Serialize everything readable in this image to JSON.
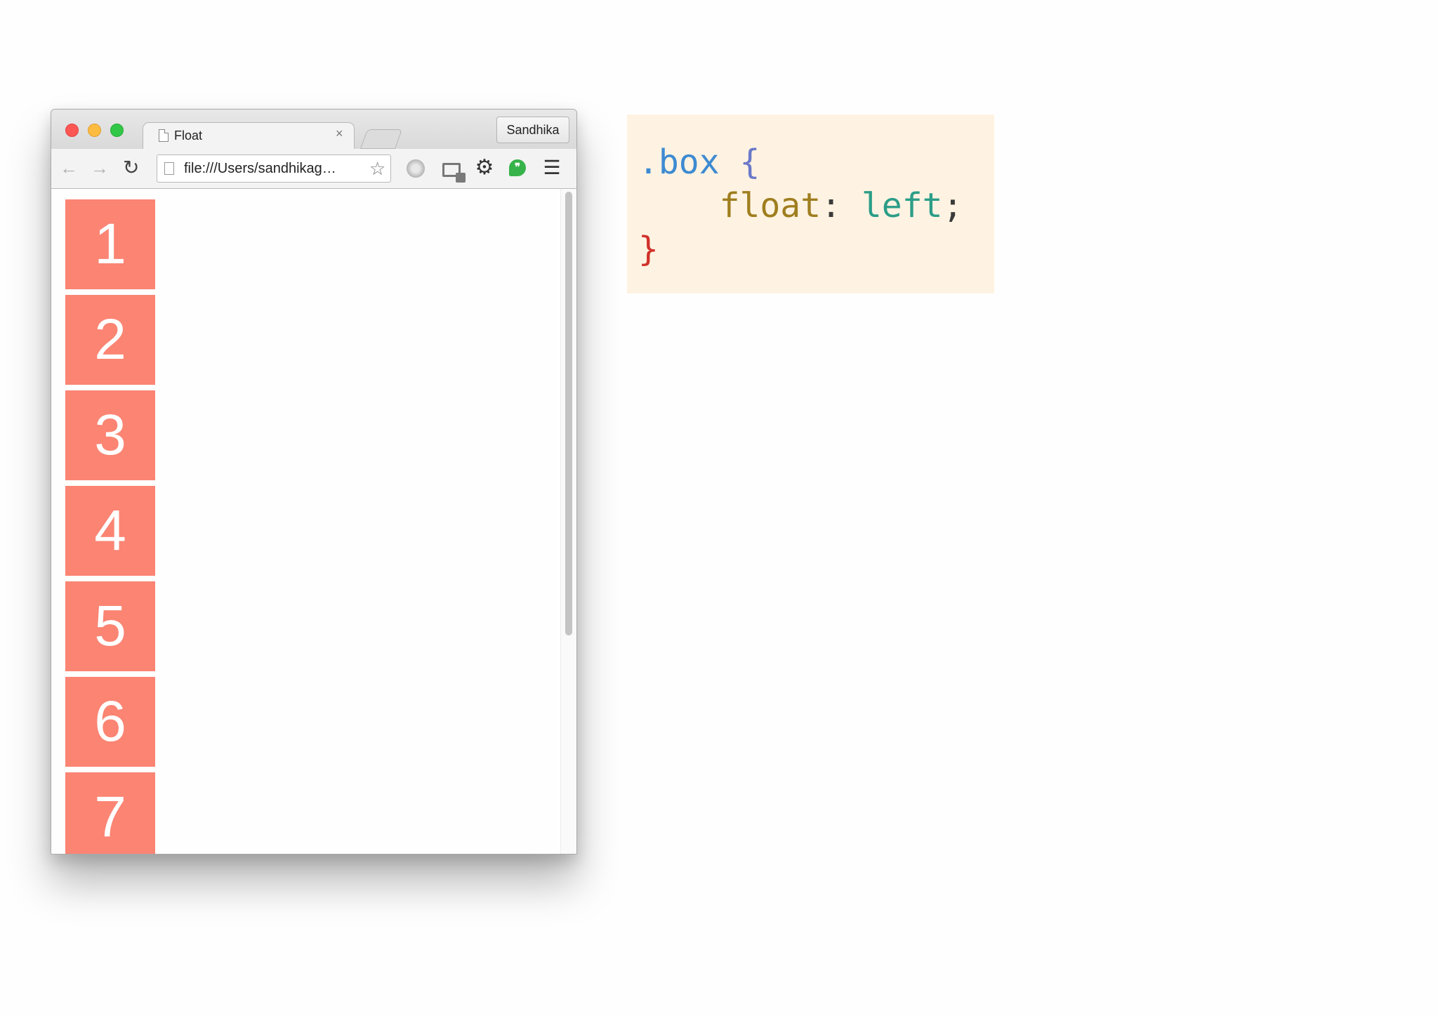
{
  "browser": {
    "tab_title": "Float",
    "tab_close": "×",
    "profile_name": "Sandhika",
    "url": "file:///Users/sandhikag…",
    "icons": {
      "back": "back-arrow-icon",
      "forward": "forward-arrow-icon",
      "reload": "reload-icon",
      "star": "bookmark-star-icon",
      "menu": "hamburger-menu-icon"
    }
  },
  "page": {
    "boxes": [
      "1",
      "2",
      "3",
      "4",
      "5",
      "6",
      "7"
    ],
    "box_color": "#fb8473"
  },
  "code": {
    "selector": ".box",
    "open_brace": "{",
    "property": "float",
    "colon": ":",
    "value": "left",
    "semicolon": ";",
    "close_brace": "}"
  }
}
